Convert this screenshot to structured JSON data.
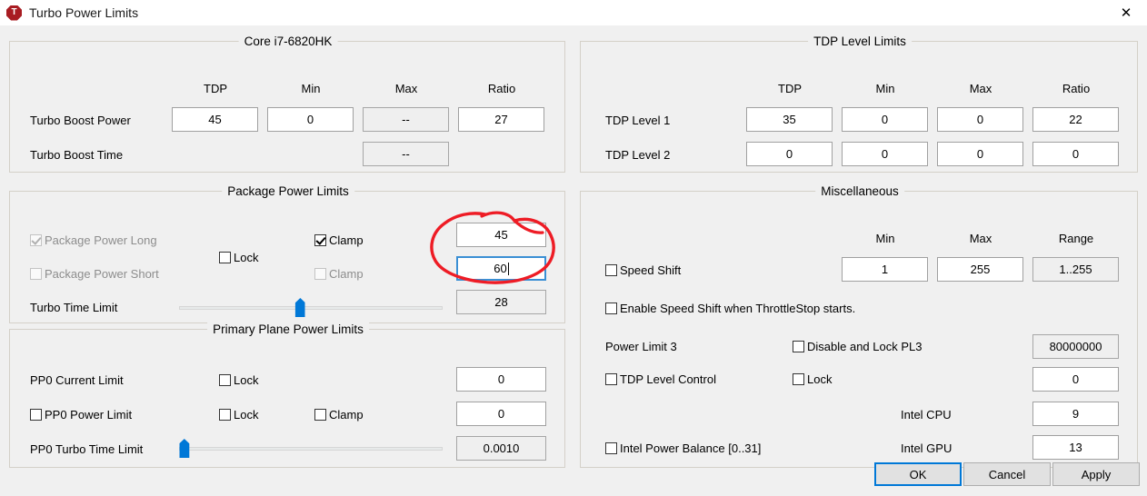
{
  "window": {
    "title": "Turbo Power Limits",
    "icon": "throttlestop-icon",
    "icon_letter": "T",
    "close_icon": "✕",
    "accent": "#0078d7",
    "annotation_color": "#ee1c25"
  },
  "cpu_group": {
    "legend": "Core i7-6820HK",
    "columns": [
      "TDP",
      "Min",
      "Max",
      "Ratio"
    ],
    "rows": [
      {
        "label": "Turbo Boost Power",
        "values": [
          "45",
          "0",
          "--",
          "27"
        ],
        "readonly": [
          false,
          false,
          true,
          false
        ]
      },
      {
        "label": "Turbo Boost Time",
        "values": [
          "--"
        ],
        "readonly": [
          true
        ]
      }
    ]
  },
  "tdp_group": {
    "legend": "TDP Level Limits",
    "columns": [
      "TDP",
      "Min",
      "Max",
      "Ratio"
    ],
    "rows": [
      {
        "label": "TDP Level 1",
        "values": [
          "35",
          "0",
          "0",
          "22"
        ]
      },
      {
        "label": "TDP Level 2",
        "values": [
          "0",
          "0",
          "0",
          "0"
        ]
      }
    ]
  },
  "package_group": {
    "legend": "Package Power Limits",
    "power_long": {
      "label": "Package Power Long",
      "checked": true,
      "disabled": true
    },
    "power_short": {
      "label": "Package Power Short",
      "checked": false,
      "disabled": true
    },
    "lock": {
      "label": "Lock",
      "checked": false,
      "disabled": false
    },
    "clamp_long": {
      "label": "Clamp",
      "checked": true,
      "disabled": false
    },
    "clamp_short": {
      "label": "Clamp",
      "checked": false,
      "disabled": true
    },
    "turbo_time_label": "Turbo Time Limit",
    "value_long": "45",
    "value_short": "60",
    "value_turbo_time": "28",
    "slider_pos_pct": 46
  },
  "primary_plane_group": {
    "legend": "Primary Plane Power Limits",
    "current_limit_label": "PP0 Current Limit",
    "current_lock": {
      "label": "Lock",
      "checked": false
    },
    "power_limit": {
      "label": "PP0 Power Limit",
      "checked": false
    },
    "power_lock": {
      "label": "Lock",
      "checked": false
    },
    "power_clamp": {
      "label": "Clamp",
      "checked": false
    },
    "turbo_time_label": "PP0 Turbo Time Limit",
    "value_current": "0",
    "value_power": "0",
    "value_turbo_time": "0.0010",
    "slider_pos_pct": 2
  },
  "misc_group": {
    "legend": "Miscellaneous",
    "columns": [
      "Min",
      "Max",
      "Range"
    ],
    "speed_shift": {
      "label": "Speed Shift",
      "checked": false
    },
    "speed_shift_min": "1",
    "speed_shift_max": "255",
    "speed_shift_range": "1..255",
    "enable_speed_shift": {
      "label": "Enable Speed Shift when ThrottleStop starts.",
      "checked": false
    },
    "power_limit_3_label": "Power Limit 3",
    "disable_lock_pl3": {
      "label": "Disable and Lock PL3",
      "checked": false
    },
    "value_pl3": "80000000",
    "tdp_level_control": {
      "label": "TDP Level Control",
      "checked": false
    },
    "tdp_lock": {
      "label": "Lock",
      "checked": false
    },
    "value_tdp_level": "0",
    "intel_power_balance": {
      "label": "Intel Power Balance  [0..31]",
      "checked": false
    },
    "intel_cpu_label": "Intel CPU",
    "intel_gpu_label": "Intel GPU",
    "value_intel_cpu": "9",
    "value_intel_gpu": "13"
  },
  "buttons": {
    "ok": "OK",
    "cancel": "Cancel",
    "apply": "Apply"
  }
}
